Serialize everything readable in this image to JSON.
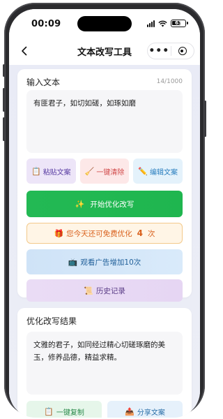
{
  "status_bar": {
    "time": "00:09",
    "battery": "63"
  },
  "nav": {
    "title": "文本改写工具"
  },
  "input_card": {
    "title": "输入文本",
    "char_count": "14/1000",
    "text": "有匪君子，如切如磋，如琢如磨",
    "actions": [
      {
        "icon": "📋",
        "icon_name": "clipboard-icon",
        "label": "粘贴文案"
      },
      {
        "icon": "🧹",
        "icon_name": "broom-icon",
        "label": "一键清除"
      },
      {
        "icon": "✏️",
        "icon_name": "pencil-icon",
        "label": "编辑文案"
      }
    ],
    "optimize": {
      "icon": "✨",
      "label": "开始优化改写"
    },
    "free_banner": {
      "icon": "🎁",
      "prefix": "您今天还可免费优化",
      "count": "4",
      "suffix": "次"
    },
    "ad": {
      "icon": "📺",
      "label": "观看广告增加10次"
    },
    "history": {
      "icon": "📜",
      "label": "历史记录"
    }
  },
  "result_card": {
    "title": "优化改写结果",
    "text": "文雅的君子，如同经过精心切磋琢磨的美玉，修养品德，精益求精。",
    "actions": [
      {
        "icon": "📋",
        "icon_name": "copy-icon",
        "label": "一键复制"
      },
      {
        "icon": "📤",
        "icon_name": "share-icon",
        "label": "分享文案"
      }
    ]
  },
  "colors": {
    "primary_green": "#23b954",
    "banner_orange": "#d9601c",
    "background": "#e9ebf6"
  }
}
